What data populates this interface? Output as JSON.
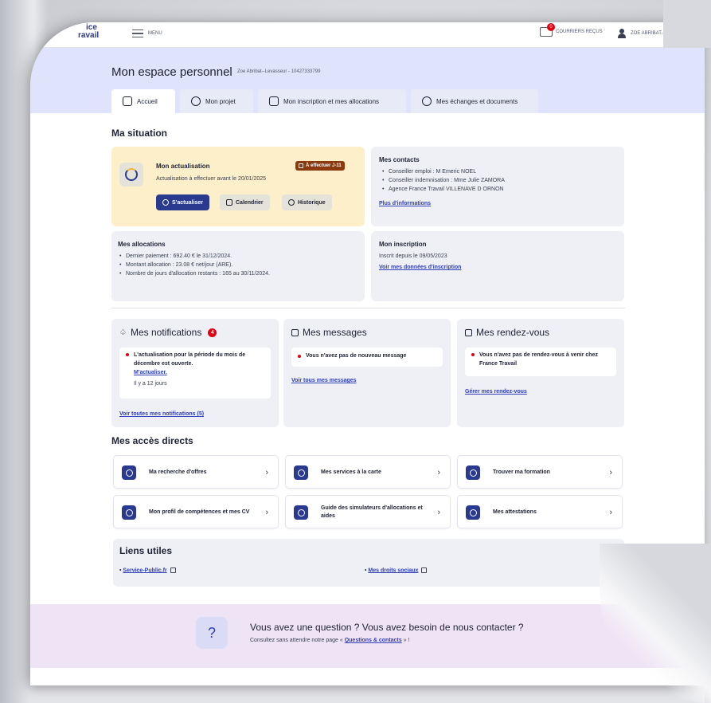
{
  "topbar": {
    "logo_line1": "ice",
    "logo_line2": "ravail",
    "menu_label": "MENU",
    "mail_label": "COURRIERS REÇUS",
    "mail_badge": "0",
    "user_name": "ZOE ABRIBAT-LEVASSEUR"
  },
  "header": {
    "title": "Mon espace personnel",
    "subtitle": "Zoe Abribat--Levasseur - 10427333799"
  },
  "tabs": [
    {
      "label": "Accueil"
    },
    {
      "label": "Mon projet"
    },
    {
      "label": "Mon inscription et mes allocations"
    },
    {
      "label": "Mes échanges et documents"
    }
  ],
  "situation": {
    "heading": "Ma situation",
    "actualisation": {
      "title": "Mon actualisation",
      "status": "À effectuer J-11",
      "text": "Actualisation à effectuer avant le 20/01/2025",
      "btn_primary": "S'actualiser",
      "btn_calendar": "Calendrier",
      "btn_history": "Historique"
    },
    "contacts": {
      "title": "Mes contacts",
      "items": [
        "Conseiller emploi : M Emeric NOEL",
        "Conseiller indemnisation : Mme Julie ZAMORA",
        "Agence France Travail VILLENAVE D ORNON"
      ],
      "link": "Plus d'informations"
    },
    "allocations": {
      "title": "Mes allocations",
      "items": [
        "Dernier paiement : 692.40 € le 31/12/2024.",
        "Montant allocation : 23.08 € net/jour (ARE).",
        "Nombre de jours d'allocation restants : 165 au 30/11/2024."
      ]
    },
    "inscription": {
      "title": "Mon inscription",
      "text": "Inscrit depuis le 09/05/2023",
      "link": "Voir mes données d'inscription"
    }
  },
  "notifications": {
    "title": "Mes notifications",
    "count": "4",
    "item_text": "L'actualisation pour la période du mois de décembre est ouverte.",
    "item_link": "M'actualiser.",
    "item_time": "Il y a 12 jours",
    "link": "Voir toutes mes notifications (5)"
  },
  "messages": {
    "title": "Mes messages",
    "item_text": "Vous n'avez pas de nouveau message",
    "link": "Voir tous mes messages"
  },
  "rdv": {
    "title": "Mes rendez-vous",
    "item_text": "Vous n'avez pas de rendez-vous à venir chez France Travail",
    "link": "Gérer mes rendez-vous"
  },
  "acces": {
    "heading": "Mes accès directs",
    "items": [
      {
        "label": "Ma recherche d'offres",
        "icon": "search-icon"
      },
      {
        "label": "Mes services à la carte",
        "icon": "services-icon"
      },
      {
        "label": "Trouver ma formation",
        "icon": "search-icon"
      },
      {
        "label": "Mon profil de compétences et mes CV",
        "icon": "profile-icon"
      },
      {
        "label": "Guide des simulateurs d'allocations et aides",
        "icon": "simulator-icon"
      },
      {
        "label": "Mes attestations",
        "icon": "attestation-icon"
      }
    ]
  },
  "liens": {
    "heading": "Liens utiles",
    "items": [
      {
        "label": "Service-Public.fr"
      },
      {
        "label": "Mes droits sociaux"
      }
    ]
  },
  "footer": {
    "icon_glyph": "?",
    "title": "Vous avez une question ? Vous avez besoin de nous contacter ?",
    "sub_prefix": "Consultez sans attendre notre page «",
    "sub_link": "Questions & contacts",
    "sub_suffix": "» !"
  },
  "colors": {
    "brand": "#2a3a8e",
    "band": "#dfe3fb",
    "alert": "#e1000f",
    "actualisation_bg": "#fcefc9",
    "footer_bg": "#efe3f6"
  }
}
